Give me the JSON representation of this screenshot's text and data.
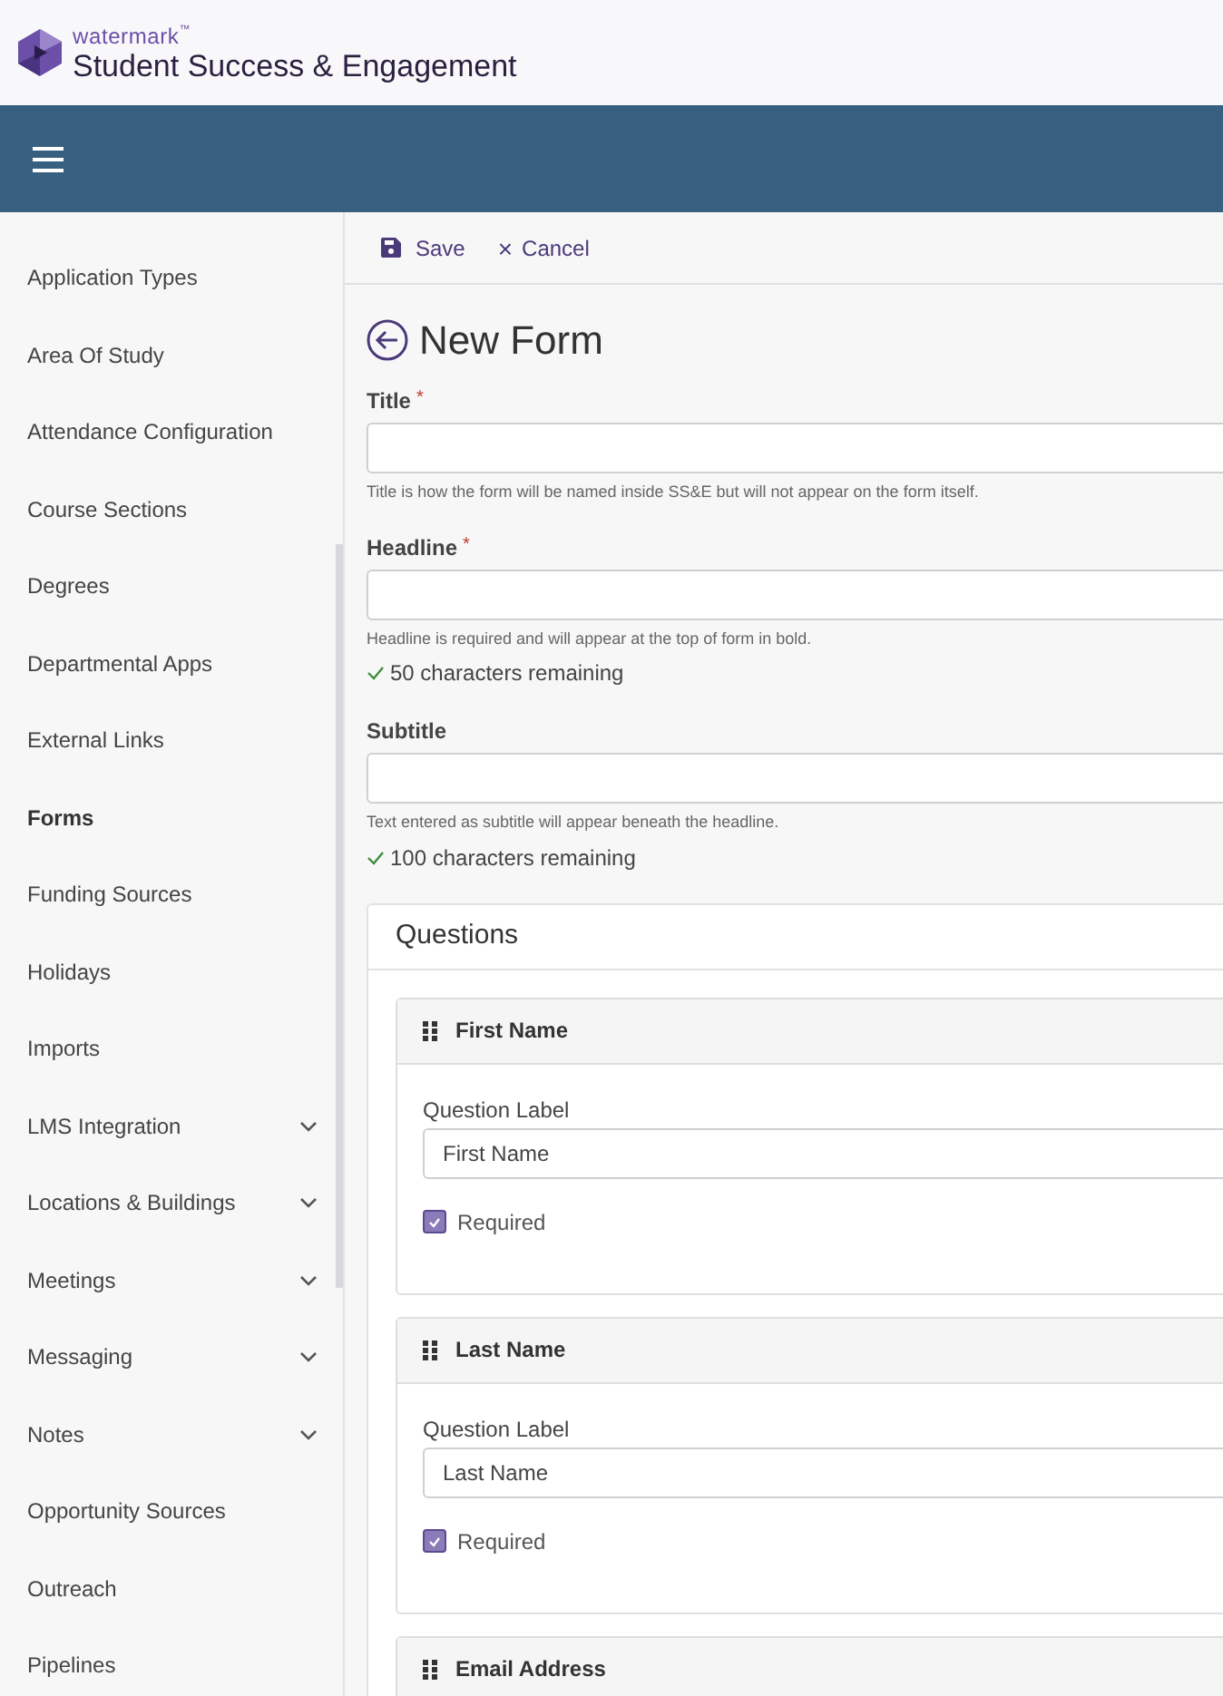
{
  "brand": {
    "company": "watermark",
    "tm": "™",
    "product": "Student Success & Engagement"
  },
  "sidebar": {
    "items": [
      {
        "label": "Application Types",
        "selected": false,
        "expandable": false
      },
      {
        "label": "Area Of Study",
        "selected": false,
        "expandable": false
      },
      {
        "label": "Attendance Configuration",
        "selected": false,
        "expandable": false
      },
      {
        "label": "Course Sections",
        "selected": false,
        "expandable": false
      },
      {
        "label": "Degrees",
        "selected": false,
        "expandable": false
      },
      {
        "label": "Departmental Apps",
        "selected": false,
        "expandable": false
      },
      {
        "label": "External Links",
        "selected": false,
        "expandable": false
      },
      {
        "label": "Forms",
        "selected": true,
        "expandable": false
      },
      {
        "label": "Funding Sources",
        "selected": false,
        "expandable": false
      },
      {
        "label": "Holidays",
        "selected": false,
        "expandable": false
      },
      {
        "label": "Imports",
        "selected": false,
        "expandable": false
      },
      {
        "label": "LMS Integration",
        "selected": false,
        "expandable": true
      },
      {
        "label": "Locations & Buildings",
        "selected": false,
        "expandable": true
      },
      {
        "label": "Meetings",
        "selected": false,
        "expandable": true
      },
      {
        "label": "Messaging",
        "selected": false,
        "expandable": true
      },
      {
        "label": "Notes",
        "selected": false,
        "expandable": true
      },
      {
        "label": "Opportunity Sources",
        "selected": false,
        "expandable": false
      },
      {
        "label": "Outreach",
        "selected": false,
        "expandable": false
      },
      {
        "label": "Pipelines",
        "selected": false,
        "expandable": false
      }
    ]
  },
  "toolbar": {
    "save": "Save",
    "cancel_icon": "×",
    "cancel": "Cancel"
  },
  "page_title": "New Form",
  "fields": [
    {
      "label": "Title",
      "required_mark": "*",
      "hint": "Title is how the form will be named inside SS&E but will not appear on the form itself."
    },
    {
      "label": "Headline",
      "required_mark": "*",
      "hint": "Headline is required and will appear at the top of form in bold.",
      "remaining": "50 characters remaining"
    },
    {
      "label": "Subtitle",
      "hint": "Text entered as subtitle will appear beneath the headline.",
      "remaining": "100 characters remaining"
    }
  ],
  "questions": {
    "title": "Questions",
    "items": [
      {
        "heading": "First Name",
        "label": "Question Label",
        "value": "First Name",
        "required_label": "Required",
        "checked": true
      },
      {
        "heading": "Last Name",
        "label": "Question Label",
        "value": "Last Name",
        "required_label": "Required",
        "checked": true
      },
      {
        "heading": "Email Address"
      }
    ]
  }
}
